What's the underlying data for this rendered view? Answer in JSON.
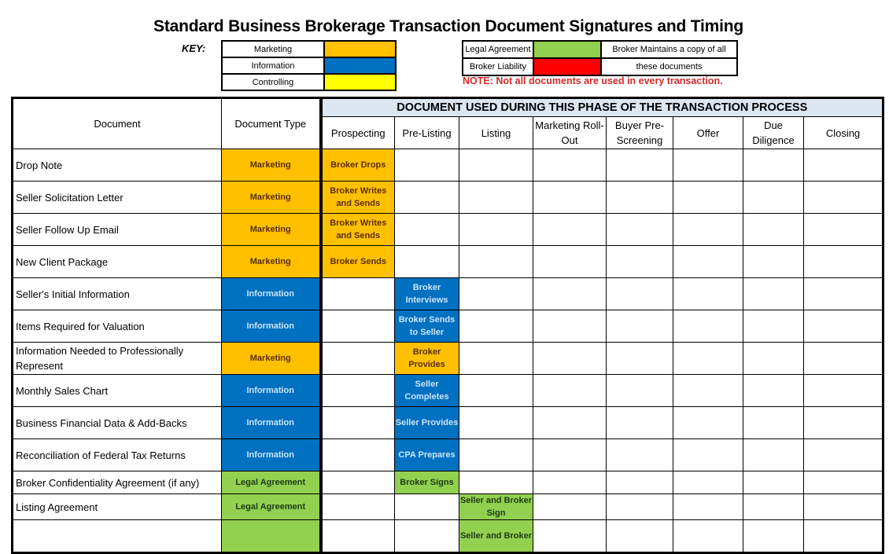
{
  "title": "Standard Business Brokerage Transaction Document Signatures and Timing",
  "key": {
    "label": "KEY:",
    "items": [
      {
        "label": "Marketing",
        "color": "#ffc000"
      },
      {
        "label": "Information",
        "color": "#0070c0"
      },
      {
        "label": "Controlling",
        "color": "#ffff00"
      }
    ],
    "items2": [
      {
        "label": "Legal Agreement",
        "color": "#92d050"
      },
      {
        "label": "Broker Liability",
        "color": "#ff0000"
      }
    ],
    "maintains_line1": "Broker Maintains a copy of all",
    "maintains_line2": "these documents",
    "note": "NOTE:  Not all documents are used in every transaction."
  },
  "table": {
    "band_title": "DOCUMENT USED DURING THIS PHASE OF THE TRANSACTION PROCESS",
    "headers": {
      "document": "Document",
      "document_type": "Document Type",
      "phases": [
        "Prospecting",
        "Pre-Listing",
        "Listing",
        "Marketing Roll-Out",
        "Buyer Pre-Screening",
        "Offer",
        "Due Diligence",
        "Closing"
      ]
    },
    "rows": [
      {
        "document": "Drop Note",
        "type": "Marketing",
        "cells": [
          "Broker Drops",
          "",
          "",
          "",
          "",
          "",
          "",
          ""
        ]
      },
      {
        "document": "Seller Solicitation Letter",
        "type": "Marketing",
        "cells": [
          "Broker Writes and Sends",
          "",
          "",
          "",
          "",
          "",
          "",
          ""
        ]
      },
      {
        "document": "Seller Follow Up Email",
        "type": "Marketing",
        "cells": [
          "Broker Writes and Sends",
          "",
          "",
          "",
          "",
          "",
          "",
          ""
        ]
      },
      {
        "document": "New Client Package",
        "type": "Marketing",
        "cells": [
          "Broker Sends",
          "",
          "",
          "",
          "",
          "",
          "",
          ""
        ]
      },
      {
        "document": "Seller's Initial Information",
        "type": "Information",
        "cells": [
          "",
          "Broker Interviews",
          "",
          "",
          "",
          "",
          "",
          ""
        ]
      },
      {
        "document": "Items Required for Valuation",
        "type": "Information",
        "cells": [
          "",
          "Broker Sends to Seller",
          "",
          "",
          "",
          "",
          "",
          ""
        ]
      },
      {
        "document": "Information Needed to Professionally Represent",
        "type": "Marketing",
        "cells": [
          "",
          "Broker Provides",
          "",
          "",
          "",
          "",
          "",
          ""
        ]
      },
      {
        "document": "Monthly Sales Chart",
        "type": "Information",
        "cells": [
          "",
          "Seller Completes",
          "",
          "",
          "",
          "",
          "",
          ""
        ]
      },
      {
        "document": "Business Financial Data & Add-Backs",
        "type": "Information",
        "cells": [
          "",
          "Seller Provides",
          "",
          "",
          "",
          "",
          "",
          ""
        ]
      },
      {
        "document": "Reconciliation of Federal Tax Returns",
        "type": "Information",
        "cells": [
          "",
          "CPA Prepares",
          "",
          "",
          "",
          "",
          "",
          ""
        ]
      },
      {
        "document": "Broker Confidentiality Agreement (if any)",
        "type": "Legal Agreement",
        "cells": [
          "",
          "Broker Signs",
          "",
          "",
          "",
          "",
          "",
          ""
        ]
      },
      {
        "document": "Listing Agreement",
        "type": "Legal Agreement",
        "cells": [
          "",
          "",
          "Seller and Broker Sign",
          "",
          "",
          "",
          "",
          ""
        ]
      },
      {
        "document": "",
        "type": "",
        "type_class": "Legal Agreement",
        "cells": [
          "",
          "",
          "Seller and Broker",
          "",
          "",
          "",
          "",
          ""
        ]
      }
    ]
  }
}
